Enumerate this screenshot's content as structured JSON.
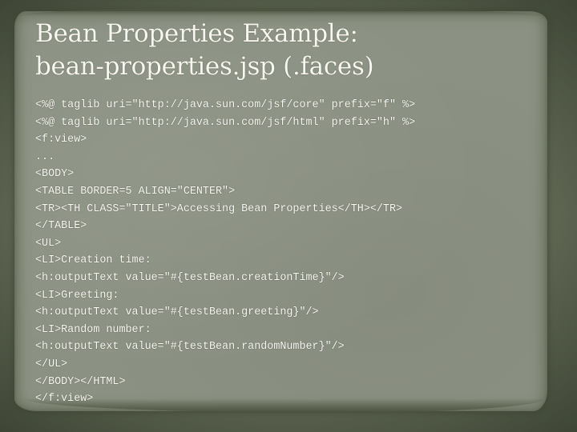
{
  "slide": {
    "title_lines": [
      "Bean Properties Example:",
      "bean-properties.jsp (.faces)"
    ],
    "code_lines": [
      "<%@ taglib uri=\"http://java.sun.com/jsf/core\" prefix=\"f\" %>",
      "<%@ taglib uri=\"http://java.sun.com/jsf/html\" prefix=\"h\" %>",
      "<f:view>",
      "...",
      "<BODY>",
      "<TABLE BORDER=5 ALIGN=\"CENTER\">",
      "<TR><TH CLASS=\"TITLE\">Accessing Bean Properties</TH></TR>",
      "</TABLE>",
      "<UL>",
      "<LI>Creation time:",
      "<h:outputText value=\"#{testBean.creationTime}\"/>",
      "<LI>Greeting:",
      "<h:outputText value=\"#{testBean.greeting}\"/>",
      "<LI>Random number:",
      "<h:outputText value=\"#{testBean.randomNumber}\"/>",
      "</UL>",
      "</BODY></HTML>",
      "</f:view>"
    ]
  },
  "colors": {
    "background": "#5b6350",
    "paper": "#8c9283",
    "text": "#f7f7f0"
  }
}
